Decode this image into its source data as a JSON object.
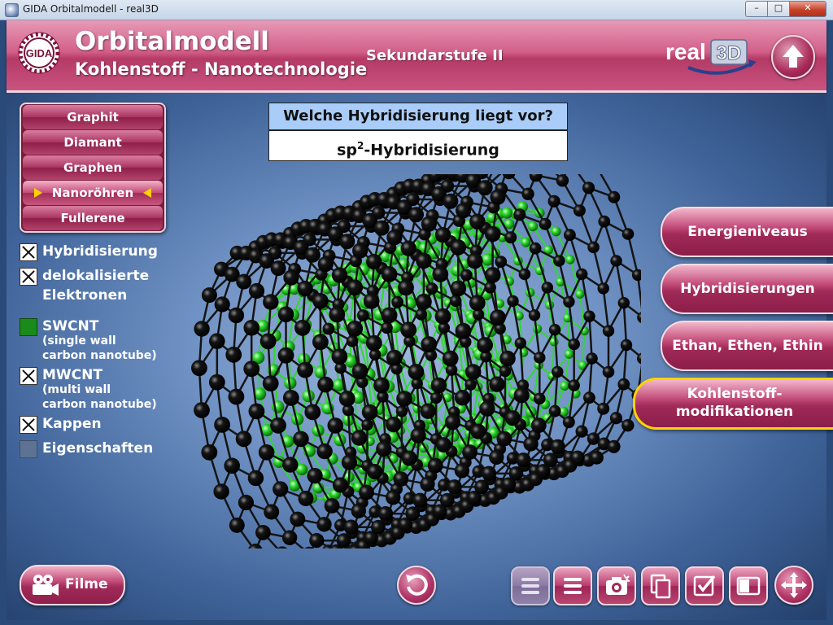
{
  "window": {
    "title": "GIDA Orbitalmodell - real3D",
    "min_label": "–",
    "max_label": "□",
    "close_label": "✕"
  },
  "header": {
    "logo_text": "GIDA",
    "title": "Orbitalmodell",
    "subtitle": "Kohlenstoff - Nanotechnologie",
    "level": "Sekundarstufe II",
    "brand": "real",
    "brand_3d": "3D",
    "up_icon": "arrow-up-icon"
  },
  "nav": {
    "items": [
      {
        "label": "Graphit",
        "active": false
      },
      {
        "label": "Diamant",
        "active": false
      },
      {
        "label": "Graphen",
        "active": false
      },
      {
        "label": "Nanoröhren",
        "active": true
      },
      {
        "label": "Fullerene",
        "active": false
      }
    ]
  },
  "options": {
    "hybridisierung": {
      "label": "Hybridisierung",
      "checked": true
    },
    "delokalisiert": {
      "line1": "delokalisierte",
      "line2": "Elektronen",
      "checked": true
    },
    "swcnt": {
      "label": "SWCNT",
      "desc1": "(single wall",
      "desc2": "carbon nanotube)",
      "color": "#1a8a1a"
    },
    "mwcnt": {
      "label": "MWCNT",
      "desc1": "(multi wall",
      "desc2": "carbon nanotube)",
      "checked": true
    },
    "kappen": {
      "label": "Kappen",
      "checked": true
    },
    "eigenschaften": {
      "label": "Eigenschaften",
      "checked": false
    }
  },
  "question": {
    "prompt": "Welche Hybridisierung liegt vor?",
    "answer_base": "sp",
    "answer_sup": "2",
    "answer_rest": "-Hybridisierung"
  },
  "right_menu": {
    "energieniveaus": "Energieniveaus",
    "hybridisierungen": "Hybridisierungen",
    "ethan": "Ethan, Ethen, Ethin",
    "kohlenstoff_1": "Kohlenstoff-",
    "kohlenstoff_2": "modifikationen"
  },
  "bottom": {
    "filme_label": "Filme",
    "tools": [
      "reset-icon",
      "list-dim-icon",
      "list-icon",
      "camera-icon",
      "copy-icon",
      "checklist-icon",
      "window-icon",
      "move-icon"
    ]
  },
  "colors": {
    "accent": "#b53a66",
    "highlight": "#ffd200",
    "question_bg": "#a9cdf8",
    "outer_tube": "#141414",
    "inner_tube": "#2fd82f"
  }
}
